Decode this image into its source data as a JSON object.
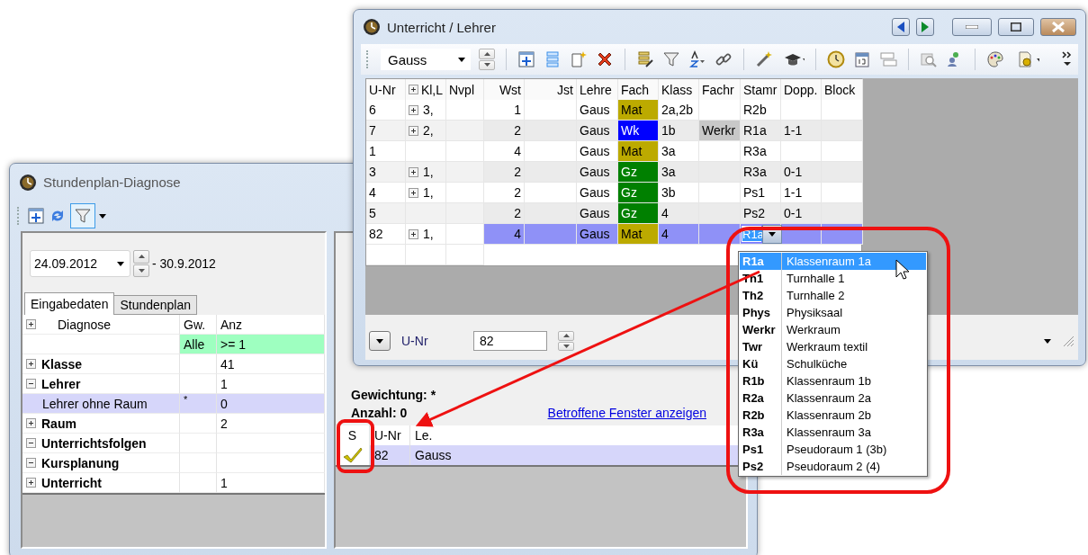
{
  "diagnose_window": {
    "title": "Stundenplan-Diagnose",
    "date_from": "24.09.2012",
    "date_to": "- 30.9.2012",
    "tabs": [
      {
        "label": "Eingabedaten",
        "selected": true
      },
      {
        "label": "Stundenplan",
        "selected": false
      }
    ],
    "grid": {
      "columns": [
        "Diagnose",
        "Gw.",
        "Anz"
      ],
      "filter": {
        "weight": "Alle",
        "count": ">= 1"
      },
      "rows": [
        {
          "label": "Klasse",
          "expanded": false,
          "weight": "",
          "count": "41",
          "selected": false
        },
        {
          "label": "Lehrer",
          "expanded": true,
          "weight": "",
          "count": "1",
          "selected": false,
          "children": [
            {
              "label": "Lehrer ohne Raum",
              "weight": "*",
              "count": "0",
              "selected": true
            }
          ]
        },
        {
          "label": "Raum",
          "expanded": false,
          "weight": "",
          "count": "2",
          "selected": false
        },
        {
          "label": "Unterrichtsfolgen",
          "expanded": true,
          "weight": "",
          "count": "",
          "selected": false
        },
        {
          "label": "Kursplanung",
          "expanded": true,
          "weight": "",
          "count": "",
          "selected": false
        },
        {
          "label": "Unterricht",
          "expanded": false,
          "weight": "",
          "count": "1",
          "selected": false
        }
      ]
    },
    "weighting": "Gewichtung: *",
    "count": "Anzahl: 0",
    "link": "Betroffene Fenster anzeigen",
    "results": {
      "columns": [
        "S",
        "U-Nr",
        "Le."
      ],
      "rows": [
        {
          "checked": true,
          "u_nr": "82",
          "teacher": "Gauss",
          "selected": true
        }
      ]
    }
  },
  "lesson_window": {
    "title": "Unterricht / Lehrer",
    "teacher": "Gauss",
    "columns": [
      "U-Nr",
      "Kl,L",
      "Nvpl",
      "Wst",
      "Jst",
      "Lehre",
      "Fach",
      "Klass",
      "Fachr",
      "Stamr",
      "Dopp.",
      "Block"
    ],
    "rows": [
      {
        "u_nr": "6",
        "kl": "3,",
        "wst": "1",
        "lehrer": "Gaus",
        "fach": "Mat",
        "color": "#bcaa00",
        "klasse": "2a,2b",
        "fachraum": "",
        "stammraum": "R2b",
        "dopp": "",
        "selected": false,
        "editing": false
      },
      {
        "u_nr": "7",
        "kl": "2,",
        "wst": "2",
        "lehrer": "Gaus",
        "fach": "Wk",
        "color": "#0000ff",
        "klasse": "1b",
        "fachraum": "Werkr",
        "stammraum": "R1a",
        "dopp": "1-1",
        "selected": false,
        "editing": false
      },
      {
        "u_nr": "1",
        "kl": "",
        "wst": "4",
        "lehrer": "Gaus",
        "fach": "Mat",
        "color": "#bcaa00",
        "klasse": "3a",
        "fachraum": "",
        "stammraum": "R3a",
        "dopp": "",
        "selected": false,
        "editing": false
      },
      {
        "u_nr": "3",
        "kl": "1,",
        "wst": "2",
        "lehrer": "Gaus",
        "fach": "Gz",
        "color": "#008000",
        "klasse": "3a",
        "fachraum": "",
        "stammraum": "R3a",
        "dopp": "0-1",
        "selected": false,
        "editing": false
      },
      {
        "u_nr": "4",
        "kl": "1,",
        "wst": "2",
        "lehrer": "Gaus",
        "fach": "Gz",
        "color": "#008000",
        "klasse": "3b",
        "fachraum": "",
        "stammraum": "Ps1",
        "dopp": "1-1",
        "selected": false,
        "editing": false
      },
      {
        "u_nr": "5",
        "kl": "",
        "wst": "2",
        "lehrer": "Gaus",
        "fach": "Gz",
        "color": "#008000",
        "klasse": "4",
        "fachraum": "",
        "stammraum": "Ps2",
        "dopp": "0-1",
        "selected": false,
        "editing": false
      },
      {
        "u_nr": "82",
        "kl": "1,",
        "wst": "4",
        "lehrer": "Gaus",
        "fach": "Mat",
        "color": "#bcaa00",
        "klasse": "4",
        "fachraum": "",
        "stammraum": "R1a",
        "dopp": "",
        "selected": true,
        "editing": true
      }
    ],
    "form": {
      "label": "U-Nr",
      "value": "82"
    }
  },
  "room_dropdown": {
    "items": [
      {
        "code": "R1a",
        "name": "Klassenraum 1a",
        "selected": true
      },
      {
        "code": "Th1",
        "name": "Turnhalle 1",
        "selected": false
      },
      {
        "code": "Th2",
        "name": "Turnhalle 2",
        "selected": false
      },
      {
        "code": "Phys",
        "name": "Physiksaal",
        "selected": false
      },
      {
        "code": "Werkr",
        "name": "Werkraum",
        "selected": false
      },
      {
        "code": "Twr",
        "name": "Werkraum textil",
        "selected": false
      },
      {
        "code": "Kü",
        "name": "Schulküche",
        "selected": false
      },
      {
        "code": "R1b",
        "name": "Klassenraum 1b",
        "selected": false
      },
      {
        "code": "R2a",
        "name": "Klassenraum 2a",
        "selected": false
      },
      {
        "code": "R2b",
        "name": "Klassenraum 2b",
        "selected": false
      },
      {
        "code": "R3a",
        "name": "Klassenraum 3a",
        "selected": false
      },
      {
        "code": "Ps1",
        "name": "Pseudoraum 1 (3b)",
        "selected": false
      },
      {
        "code": "Ps2",
        "name": "Pseudoraum 2 (4)",
        "selected": false
      }
    ]
  }
}
